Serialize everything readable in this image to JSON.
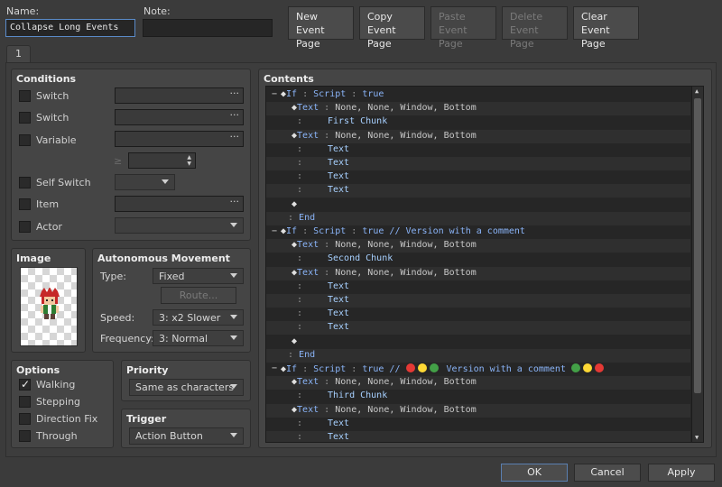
{
  "header": {
    "name_label": "Name:",
    "name_value": "Collapse Long Events",
    "note_label": "Note:",
    "note_value": ""
  },
  "toolbar": {
    "new_page": [
      "New",
      "Event Page"
    ],
    "copy_page": [
      "Copy",
      "Event Page"
    ],
    "paste_page": [
      "Paste",
      "Event Page"
    ],
    "delete_page": [
      "Delete",
      "Event Page"
    ],
    "clear_page": [
      "Clear",
      "Event Page"
    ]
  },
  "tabs": {
    "page1": "1"
  },
  "conditions": {
    "title": "Conditions",
    "switch1": "Switch",
    "switch2": "Switch",
    "variable": "Variable",
    "gte_symbol": "≥",
    "self_switch": "Self Switch",
    "item": "Item",
    "actor": "Actor"
  },
  "image": {
    "title": "Image"
  },
  "autonomous": {
    "title": "Autonomous Movement",
    "type_label": "Type:",
    "type_value": "Fixed",
    "route_button": "Route...",
    "speed_label": "Speed:",
    "speed_value": "3: x2 Slower",
    "frequency_label": "Frequency:",
    "frequency_value": "3: Normal"
  },
  "options": {
    "title": "Options",
    "walking": "Walking",
    "stepping": "Stepping",
    "direction_fix": "Direction Fix",
    "through": "Through"
  },
  "priority": {
    "title": "Priority",
    "value": "Same as characters"
  },
  "trigger": {
    "title": "Trigger",
    "value": "Action Button"
  },
  "contents": {
    "title": "Contents",
    "lines": [
      {
        "indent": 0,
        "collapse": true,
        "parts": [
          [
            "kw",
            "If"
          ],
          [
            "sep",
            " : "
          ],
          [
            "kw",
            "Script"
          ],
          [
            "sep",
            " : "
          ],
          [
            "kw",
            "true"
          ]
        ]
      },
      {
        "indent": 1,
        "parts": [
          [
            "kw",
            "Text"
          ],
          [
            "sep",
            " : "
          ],
          [
            "tx",
            "None, None, Window, Bottom"
          ]
        ]
      },
      {
        "indent": 1,
        "cont": true,
        "parts": [
          [
            "tb",
            "First Chunk"
          ]
        ]
      },
      {
        "indent": 1,
        "parts": [
          [
            "kw",
            "Text"
          ],
          [
            "sep",
            " : "
          ],
          [
            "tx",
            "None, None, Window, Bottom"
          ]
        ]
      },
      {
        "indent": 1,
        "cont": true,
        "parts": [
          [
            "tb",
            "Text"
          ]
        ]
      },
      {
        "indent": 1,
        "cont": true,
        "parts": [
          [
            "tb",
            "Text"
          ]
        ]
      },
      {
        "indent": 1,
        "cont": true,
        "parts": [
          [
            "tb",
            "Text"
          ]
        ]
      },
      {
        "indent": 1,
        "cont": true,
        "parts": [
          [
            "tb",
            "Text"
          ]
        ]
      },
      {
        "indent": 1,
        "empty": true,
        "parts": []
      },
      {
        "indent": 0,
        "end": true,
        "parts": [
          [
            "kw",
            "End"
          ]
        ]
      },
      {
        "indent": 0,
        "collapse": true,
        "parts": [
          [
            "kw",
            "If"
          ],
          [
            "sep",
            " : "
          ],
          [
            "kw",
            "Script"
          ],
          [
            "sep",
            " : "
          ],
          [
            "kw",
            "true // Version with a comment"
          ]
        ]
      },
      {
        "indent": 1,
        "parts": [
          [
            "kw",
            "Text"
          ],
          [
            "sep",
            " : "
          ],
          [
            "tx",
            "None, None, Window, Bottom"
          ]
        ]
      },
      {
        "indent": 1,
        "cont": true,
        "parts": [
          [
            "tb",
            "Second Chunk"
          ]
        ]
      },
      {
        "indent": 1,
        "parts": [
          [
            "kw",
            "Text"
          ],
          [
            "sep",
            " : "
          ],
          [
            "tx",
            "None, None, Window, Bottom"
          ]
        ]
      },
      {
        "indent": 1,
        "cont": true,
        "parts": [
          [
            "tb",
            "Text"
          ]
        ]
      },
      {
        "indent": 1,
        "cont": true,
        "parts": [
          [
            "tb",
            "Text"
          ]
        ]
      },
      {
        "indent": 1,
        "cont": true,
        "parts": [
          [
            "tb",
            "Text"
          ]
        ]
      },
      {
        "indent": 1,
        "cont": true,
        "parts": [
          [
            "tb",
            "Text"
          ]
        ]
      },
      {
        "indent": 1,
        "empty": true,
        "parts": []
      },
      {
        "indent": 0,
        "end": true,
        "parts": [
          [
            "kw",
            "End"
          ]
        ]
      },
      {
        "indent": 0,
        "collapse": true,
        "emoji": true,
        "parts": [
          [
            "kw",
            "If"
          ],
          [
            "sep",
            " : "
          ],
          [
            "kw",
            "Script"
          ],
          [
            "sep",
            " : "
          ],
          [
            "kw",
            "true // "
          ]
        ],
        "emoji_mid": "Version with a comment"
      },
      {
        "indent": 1,
        "parts": [
          [
            "kw",
            "Text"
          ],
          [
            "sep",
            " : "
          ],
          [
            "tx",
            "None, None, Window, Bottom"
          ]
        ]
      },
      {
        "indent": 1,
        "cont": true,
        "parts": [
          [
            "tb",
            "Third Chunk"
          ]
        ]
      },
      {
        "indent": 1,
        "parts": [
          [
            "kw",
            "Text"
          ],
          [
            "sep",
            " : "
          ],
          [
            "tx",
            "None, None, Window, Bottom"
          ]
        ]
      },
      {
        "indent": 1,
        "cont": true,
        "parts": [
          [
            "tb",
            "Text"
          ]
        ]
      },
      {
        "indent": 1,
        "cont": true,
        "parts": [
          [
            "tb",
            "Text"
          ]
        ]
      }
    ]
  },
  "colors": {
    "red": "#e53935",
    "yellow": "#fdd835",
    "green": "#43a047"
  },
  "footer": {
    "ok": "OK",
    "cancel": "Cancel",
    "apply": "Apply"
  }
}
